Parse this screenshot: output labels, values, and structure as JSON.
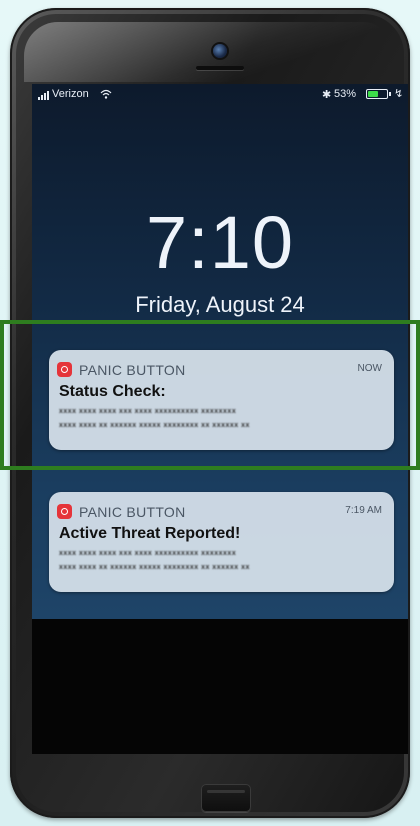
{
  "status_bar": {
    "carrier": "Verizon",
    "signal_icon": "signal-bars-icon",
    "wifi_icon": "wifi-icon",
    "bluetooth_icon": "bluetooth-icon",
    "bluetooth_glyph": "✱",
    "battery_percent": "53%",
    "battery_level": 0.53,
    "battery_color": "#3ddc4a",
    "charging_icon": "charging-icon",
    "charging_glyph": "↯"
  },
  "lock_screen": {
    "time": "7:10",
    "date": "Friday, August 24"
  },
  "notifications": [
    {
      "app_icon": "panic-button-app-icon",
      "app_name": "PANIC BUTTON",
      "time": "NOW",
      "title": "Status Check:",
      "body_line_1": "xxxx xxxx xxxx xxx xxxx xxxxxxxxxx xxxxxxxx",
      "body_line_2": "xxxx xxxx xx xxxxxx xxxxx xxxxxxxx xx xxxxxx xx"
    },
    {
      "app_icon": "panic-button-app-icon",
      "app_name": "PANIC BUTTON",
      "time": "7:19 AM",
      "title": "Active Threat Reported!",
      "body_line_1": "xxxx xxxx xxxx xxx xxxx xxxxxxxxxx xxxxxxxx",
      "body_line_2": "xxxx xxxx xx xxxxxx xxxxx xxxxxxxx xx xxxxxx xx"
    }
  ],
  "colors": {
    "app_icon": "#e5343a",
    "highlight": "#2e7d1f",
    "notification_bg": "#d6e0ea"
  }
}
